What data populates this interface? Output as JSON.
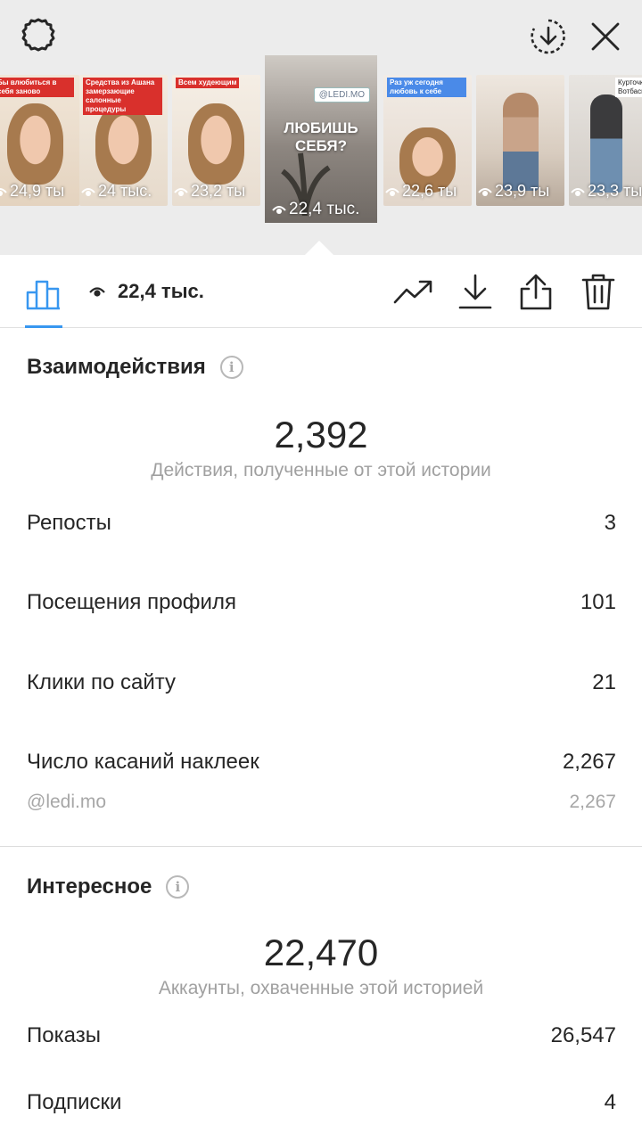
{
  "header": {
    "settings_icon": "gear-icon",
    "download_icon": "download-circle-icon",
    "close_icon": "close-icon"
  },
  "thumbnails": [
    {
      "caption": "Бы влюбиться в себя заново",
      "views": "24,9 ты"
    },
    {
      "caption": "Средства из Ашана замерзающие салонные процедуры",
      "views": "24 тыс."
    },
    {
      "caption": "Всем худеющим",
      "views": "23,2 ты"
    },
    {
      "caption": "ЛЮБИШЬ СЕБЯ?",
      "badge": "@LEDI.MO",
      "views": "22,4 тыс.",
      "selected": true
    },
    {
      "caption": "Раз уж сегодня любовь к себе",
      "views": "22,6 ты"
    },
    {
      "caption": "",
      "views": "23,9 ты"
    },
    {
      "caption": "Курточка из Вотбасменовская",
      "views": "23,3 ты"
    }
  ],
  "toolbar": {
    "views": "22,4 тыс.",
    "icons": [
      "bar-chart-icon",
      "eye-icon",
      "trending-icon",
      "download-icon",
      "share-icon",
      "trash-icon"
    ]
  },
  "interactions": {
    "title": "Взаимодействия",
    "total": "2,392",
    "total_label": "Действия, полученные от этой истории",
    "rows": [
      {
        "label": "Репосты",
        "value": "3"
      },
      {
        "label": "Посещения профиля",
        "value": "101"
      },
      {
        "label": "Клики по сайту",
        "value": "21"
      },
      {
        "label": "Число касаний наклеек",
        "value": "2,267"
      }
    ],
    "sub_row": {
      "label": "@ledi.mo",
      "value": "2,267"
    }
  },
  "discovery": {
    "title": "Интересное",
    "total": "22,470",
    "total_label": "Аккаунты, охваченные этой историей",
    "rows": [
      {
        "label": "Показы",
        "value": "26,547"
      },
      {
        "label": "Подписки",
        "value": "4"
      }
    ]
  },
  "colors": {
    "accent": "#3897f0",
    "text": "#262626",
    "muted": "#a0a0a0"
  }
}
